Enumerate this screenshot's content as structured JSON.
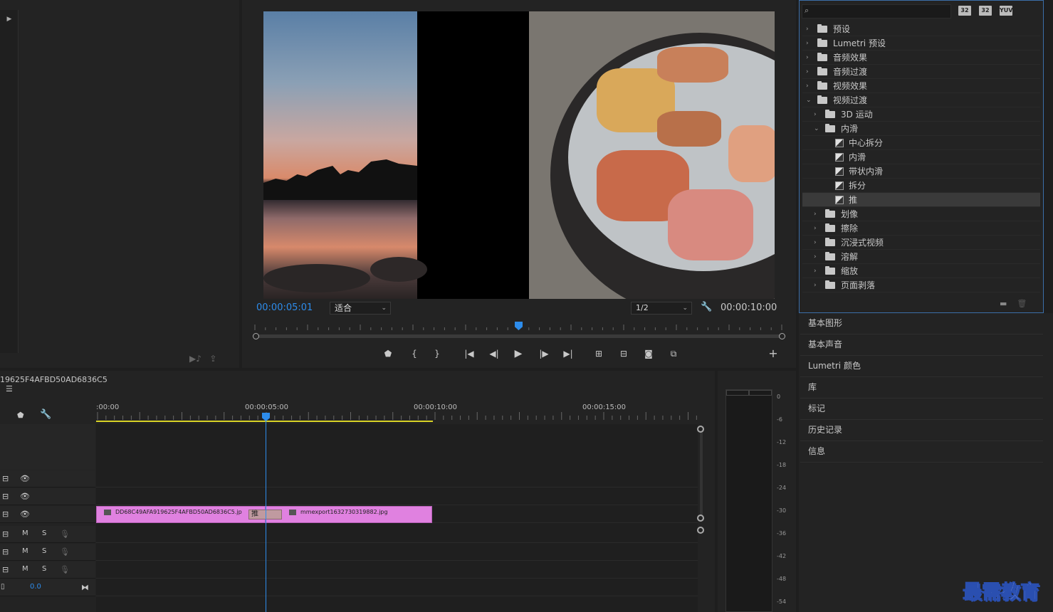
{
  "program": {
    "timecode_current": "00:00:05:01",
    "zoom": "适合",
    "resolution": "1/2",
    "timecode_duration": "00:00:10:00"
  },
  "effects": {
    "search_placeholder": "",
    "badges": [
      "32",
      "32",
      "YUV"
    ],
    "tree": [
      {
        "label": "预设",
        "level": 0,
        "expanded": false,
        "type": "preset-folder"
      },
      {
        "label": "Lumetri 预设",
        "level": 0,
        "expanded": false,
        "type": "preset-folder"
      },
      {
        "label": "音频效果",
        "level": 0,
        "expanded": false,
        "type": "folder"
      },
      {
        "label": "音频过渡",
        "level": 0,
        "expanded": false,
        "type": "folder"
      },
      {
        "label": "视频效果",
        "level": 0,
        "expanded": false,
        "type": "folder"
      },
      {
        "label": "视频过渡",
        "level": 0,
        "expanded": true,
        "type": "folder"
      },
      {
        "label": "3D 运动",
        "level": 1,
        "expanded": false,
        "type": "folder"
      },
      {
        "label": "内滑",
        "level": 1,
        "expanded": true,
        "type": "folder"
      },
      {
        "label": "中心拆分",
        "level": 2,
        "type": "transition"
      },
      {
        "label": "内滑",
        "level": 2,
        "type": "transition"
      },
      {
        "label": "带状内滑",
        "level": 2,
        "type": "transition"
      },
      {
        "label": "拆分",
        "level": 2,
        "type": "transition"
      },
      {
        "label": "推",
        "level": 2,
        "type": "transition",
        "selected": true
      },
      {
        "label": "划像",
        "level": 1,
        "expanded": false,
        "type": "folder"
      },
      {
        "label": "擦除",
        "level": 1,
        "expanded": false,
        "type": "folder"
      },
      {
        "label": "沉浸式视频",
        "level": 1,
        "expanded": false,
        "type": "folder"
      },
      {
        "label": "溶解",
        "level": 1,
        "expanded": false,
        "type": "folder"
      },
      {
        "label": "缩放",
        "level": 1,
        "expanded": false,
        "type": "folder"
      },
      {
        "label": "页面剥落",
        "level": 1,
        "expanded": false,
        "type": "folder"
      }
    ]
  },
  "side_panels": [
    "基本图形",
    "基本声音",
    "Lumetri 颜色",
    "库",
    "标记",
    "历史记录",
    "信息"
  ],
  "timeline": {
    "sequence_name": "19625F4AFBD50AD6836C5",
    "ruler_labels": [
      ":00:00",
      "00:00:05:00",
      "00:00:10:00",
      "00:00:15:00"
    ],
    "audio_track_value": "0.0",
    "track_m": "M",
    "track_s": "S",
    "clips": [
      {
        "name": "DD68C49AFA919625F4AFBD50AD6836C5.jp"
      },
      {
        "name": "mmexport1632730319882.jpg"
      }
    ],
    "transition_label": "推"
  },
  "meter": {
    "db_labels": [
      "0",
      "-6",
      "-12",
      "-18",
      "-24",
      "-30",
      "-36",
      "-42",
      "-48",
      "-54"
    ]
  },
  "watermark": "最需教育",
  "colors": {
    "accent_blue": "#2d8ceb",
    "clip_pink": "#e081e0",
    "workarea_yellow": "#d8d226"
  }
}
